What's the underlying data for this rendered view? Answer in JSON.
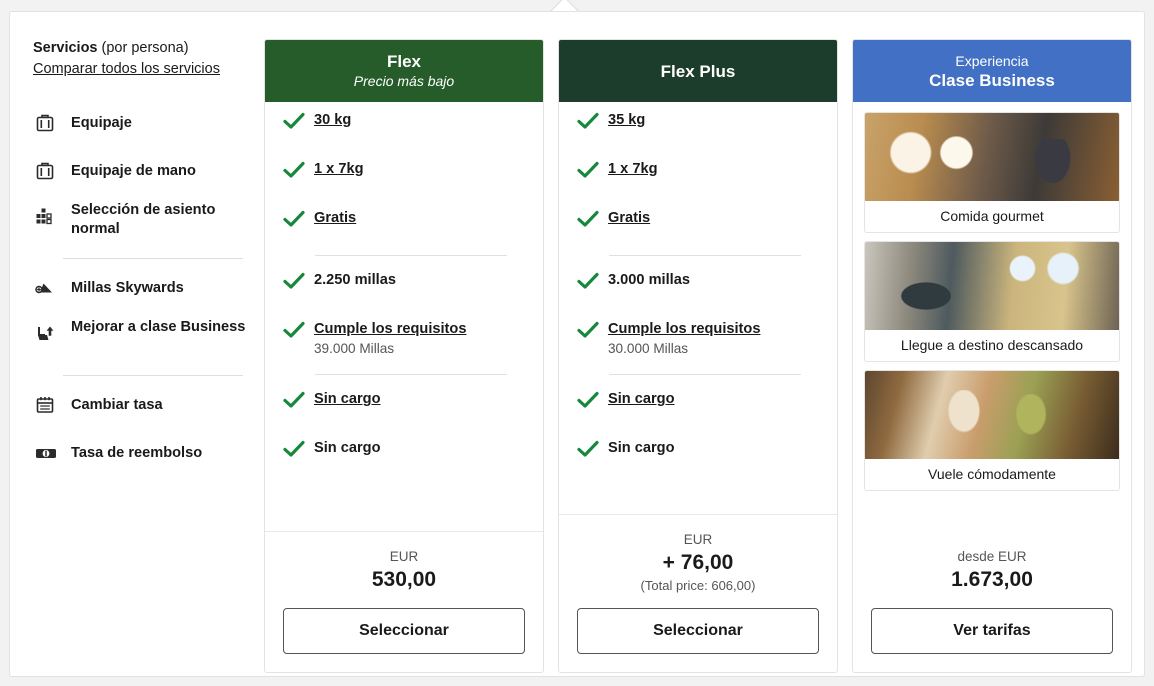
{
  "sidebar": {
    "title_bold": "Servicios",
    "title_rest": " (por persona)",
    "compare_link": "Comparar todos los servicios",
    "items": [
      {
        "label": "Equipaje",
        "icon": "suitcase-icon"
      },
      {
        "label": "Equipaje de mano",
        "icon": "carryon-suitcase-icon"
      },
      {
        "label": "Selección de asiento normal",
        "icon": "seat-grid-icon"
      },
      {
        "label": "Millas Skywards",
        "icon": "skywards-wing-icon"
      },
      {
        "label": "Mejorar a clase Business",
        "icon": "seat-upgrade-icon"
      },
      {
        "label": "Cambiar tasa",
        "icon": "calendar-icon"
      },
      {
        "label": "Tasa de reembolso",
        "icon": "banknote-icon"
      }
    ]
  },
  "colors": {
    "flex_header": "#265c2a",
    "flexplus_header": "#1d3d2c",
    "business_header": "#4270c4",
    "check_green": "#17883b"
  },
  "cards": [
    {
      "id": "flex",
      "header_main": "Flex",
      "header_sub": "Precio más bajo",
      "features": [
        {
          "main": "30 kg",
          "underline": true,
          "sub": ""
        },
        {
          "main": "1 x 7kg",
          "underline": true,
          "sub": ""
        },
        {
          "main": "Gratis",
          "underline": true,
          "sub": ""
        },
        {
          "main": "2.250 millas",
          "underline": false,
          "sub": ""
        },
        {
          "main": "Cumple los requisitos",
          "underline": true,
          "sub": "39.000 Millas"
        },
        {
          "main": "Sin cargo",
          "underline": true,
          "sub": ""
        },
        {
          "main": "Sin cargo",
          "underline": false,
          "sub": ""
        }
      ],
      "currency": "EUR",
      "price": "530,00",
      "total_note": "",
      "cta": "Seleccionar"
    },
    {
      "id": "flex-plus",
      "header_main": "Flex Plus",
      "header_sub": "",
      "features": [
        {
          "main": "35 kg",
          "underline": true,
          "sub": ""
        },
        {
          "main": "1 x 7kg",
          "underline": true,
          "sub": ""
        },
        {
          "main": "Gratis",
          "underline": true,
          "sub": ""
        },
        {
          "main": "3.000 millas",
          "underline": false,
          "sub": ""
        },
        {
          "main": "Cumple los requisitos",
          "underline": true,
          "sub": "30.000 Millas"
        },
        {
          "main": "Sin cargo",
          "underline": true,
          "sub": ""
        },
        {
          "main": "Sin cargo",
          "underline": false,
          "sub": ""
        }
      ],
      "currency": "EUR",
      "price": "+ 76,00",
      "total_note": "(Total price: 606,00)",
      "cta": "Seleccionar"
    }
  ],
  "business": {
    "header_top": "Experiencia",
    "header_main": "Clase Business",
    "tiles": [
      {
        "caption": "Comida gourmet",
        "image": "business-dining-photo"
      },
      {
        "caption": "Llegue a destino descansado",
        "image": "flat-bed-photo"
      },
      {
        "caption": "Vuele cómodamente",
        "image": "cabin-comfort-photo"
      }
    ],
    "currency": "desde EUR",
    "price": "1.673,00",
    "cta": "Ver tarifas"
  }
}
